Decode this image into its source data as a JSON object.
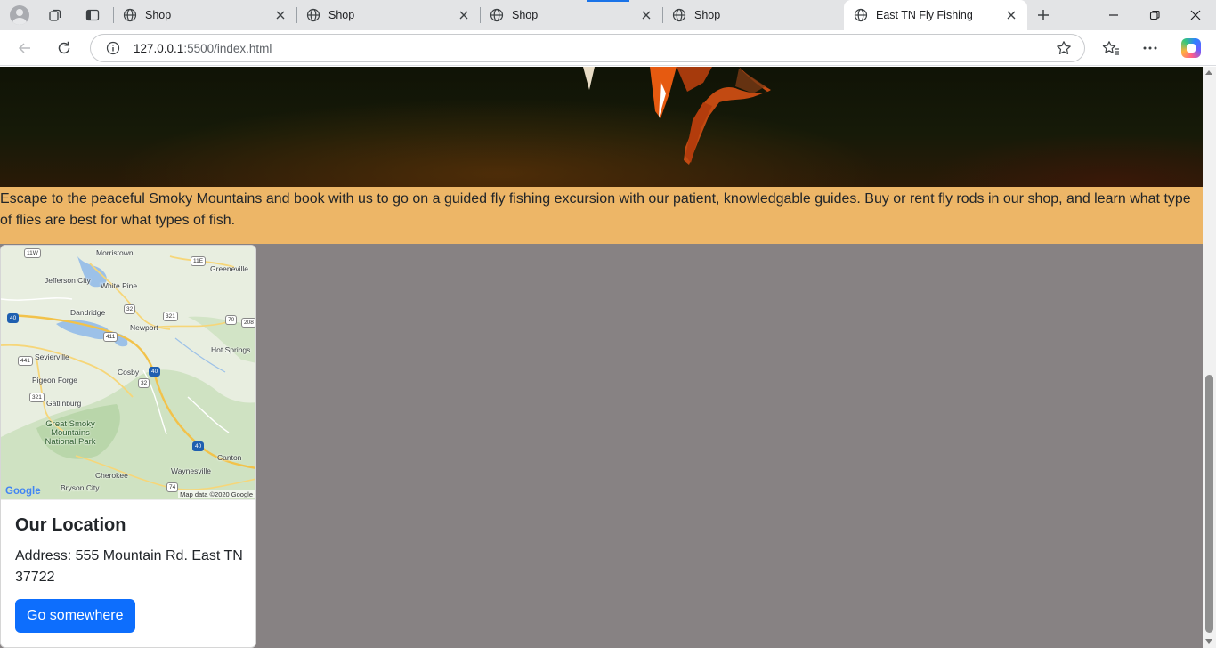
{
  "browser": {
    "tabs": [
      {
        "title": "Shop",
        "active": false
      },
      {
        "title": "Shop",
        "active": false
      },
      {
        "title": "Shop",
        "active": false
      },
      {
        "title": "Shop",
        "active": false
      },
      {
        "title": "East TN Fly Fishing",
        "active": true
      }
    ],
    "url_host": "127.0.0.1",
    "url_path": ":5500/index.html",
    "icons": [
      "profile-icon",
      "workspaces-icon",
      "tab-actions-icon",
      "globe-icon",
      "close-icon",
      "new-tab-icon",
      "minimize-icon",
      "restore-icon",
      "close-window-icon",
      "back-icon",
      "refresh-icon",
      "site-info-icon",
      "favorite-star-icon",
      "favorites-icon",
      "more-icon",
      "copilot-icon"
    ]
  },
  "page": {
    "intro_text": "Escape to the peaceful Smoky Mountains and book with us to go on a guided fly fishing excursion with our patient, knowledgable guides. Buy or rent fly rods in our shop, and learn what type of flies are best for what types of fish.",
    "card": {
      "title": "Our Location",
      "text": "Address: 555 Mountain Rd. East TN 37722",
      "button": "Go somewhere"
    },
    "map": {
      "towns": [
        "Morristown",
        "Greeneville",
        "Jefferson City",
        "White Pine",
        "Dandridge",
        "Newport",
        "Hot Springs",
        "Sevierville",
        "Cosby",
        "Pigeon Forge",
        "Gatlinburg",
        "Canton",
        "Waynesville",
        "Cherokee",
        "Bryson City"
      ],
      "park": "Great Smoky Mountains National Park",
      "shields": [
        "11W",
        "11E",
        "40",
        "32",
        "321",
        "70",
        "208",
        "411",
        "441",
        "40",
        "32",
        "321",
        "40",
        "74"
      ],
      "logo": "Google",
      "credit": "Map data ©2020 Google"
    }
  },
  "colors": {
    "intro_bg": "#edb667",
    "page_bg": "#878283",
    "button_bg": "#0d6efd"
  }
}
